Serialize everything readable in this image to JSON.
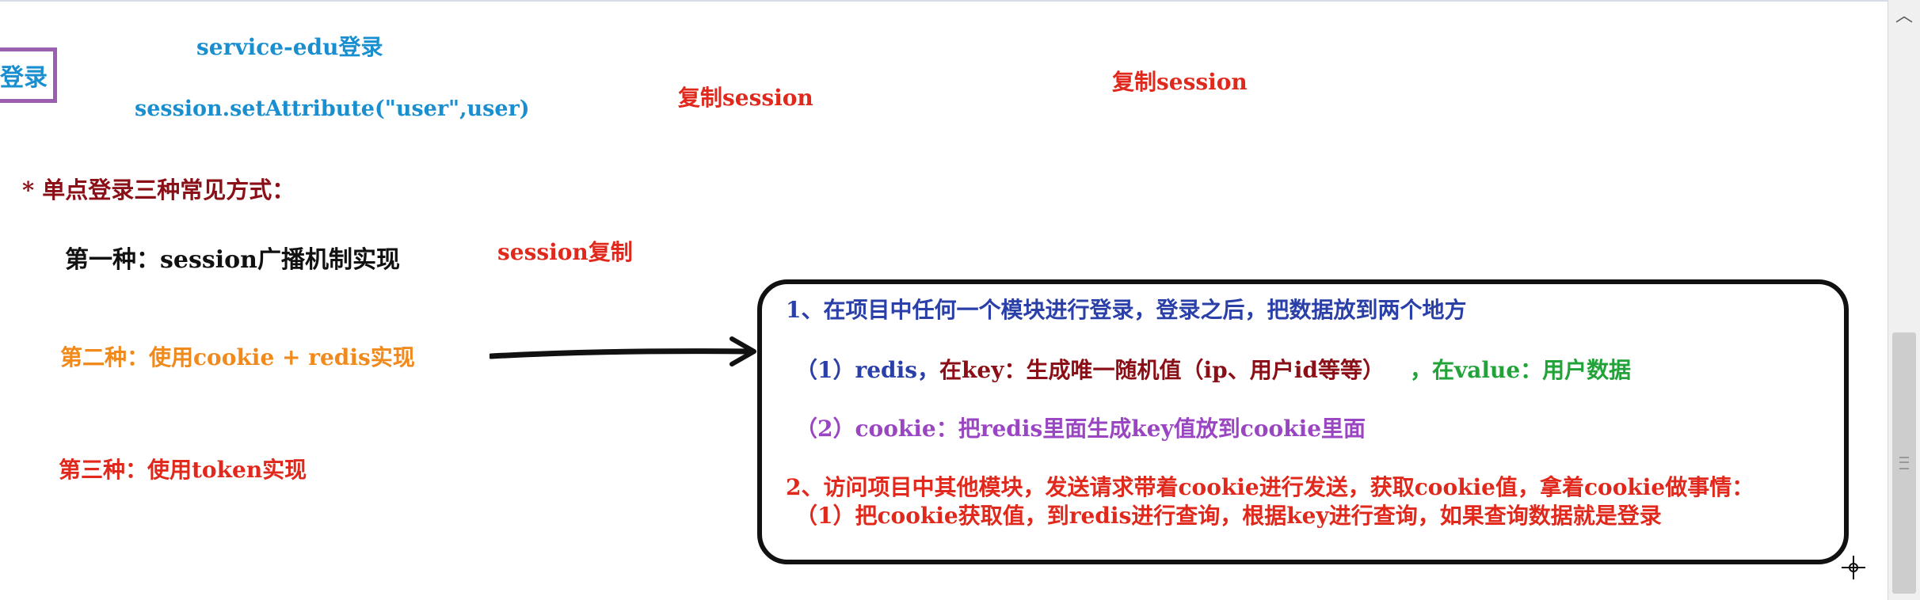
{
  "header": {
    "service_label": "service-edu登录",
    "login_box_label": "登录",
    "session_code": "session.setAttribute(\"user\",user)",
    "copy_session_1": "复制session",
    "copy_session_2": "复制session"
  },
  "methods": {
    "heading": "* 单点登录三种常见方式：",
    "first": "第一种：session广播机制实现",
    "first_note": "session复制",
    "second": "第二种：使用cookie + redis实现",
    "third": "第三种：使用token实现"
  },
  "note": {
    "line1": "1、在项目中任何一个模块进行登录，登录之后，把数据放到两个地方",
    "line2_prefix": "（1）redis，",
    "line2_key": "在key：生成唯一随机值（ip、用户id等等）",
    "line2_value": "，在value：用户数据",
    "line3": "（2）cookie：把redis里面生成key值放到cookie里面",
    "line4": "2、访问项目中其他模块，发送请求带着cookie进行发送，获取cookie值，拿着cookie做事情：",
    "line5": "（1）把cookie获取值，到redis进行查询，根据key进行查询，如果查询数据就是登录"
  },
  "icons": {
    "scroll_up": "chevron-up-icon",
    "scroll_grip": "grip-icon",
    "cursor": "crosshair-cursor-icon",
    "arrow": "right-arrow-icon"
  },
  "colors": {
    "blue": "#1a8fd0",
    "red": "#e0291c",
    "dark_red": "#8b0f16",
    "orange": "#f08a1c",
    "navy": "#2a3fa8",
    "green": "#22a33a",
    "purple": "#9a45c2"
  }
}
